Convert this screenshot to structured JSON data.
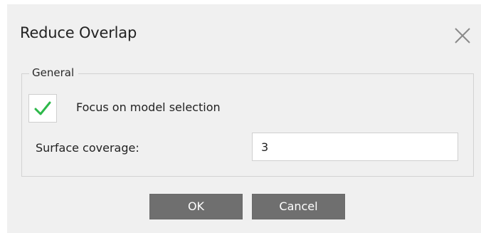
{
  "dialog": {
    "title": "Reduce Overlap",
    "close_icon": "close-icon"
  },
  "general_group": {
    "legend": "General",
    "focus_checkbox": {
      "label": "Focus on model selection",
      "checked": true,
      "check_icon": "checkmark-icon",
      "check_color": "#2db84a"
    },
    "surface_coverage": {
      "label": "Surface coverage:",
      "value": "3"
    }
  },
  "buttons": {
    "ok_label": "OK",
    "cancel_label": "Cancel",
    "button_color": "#6f6f6f"
  }
}
